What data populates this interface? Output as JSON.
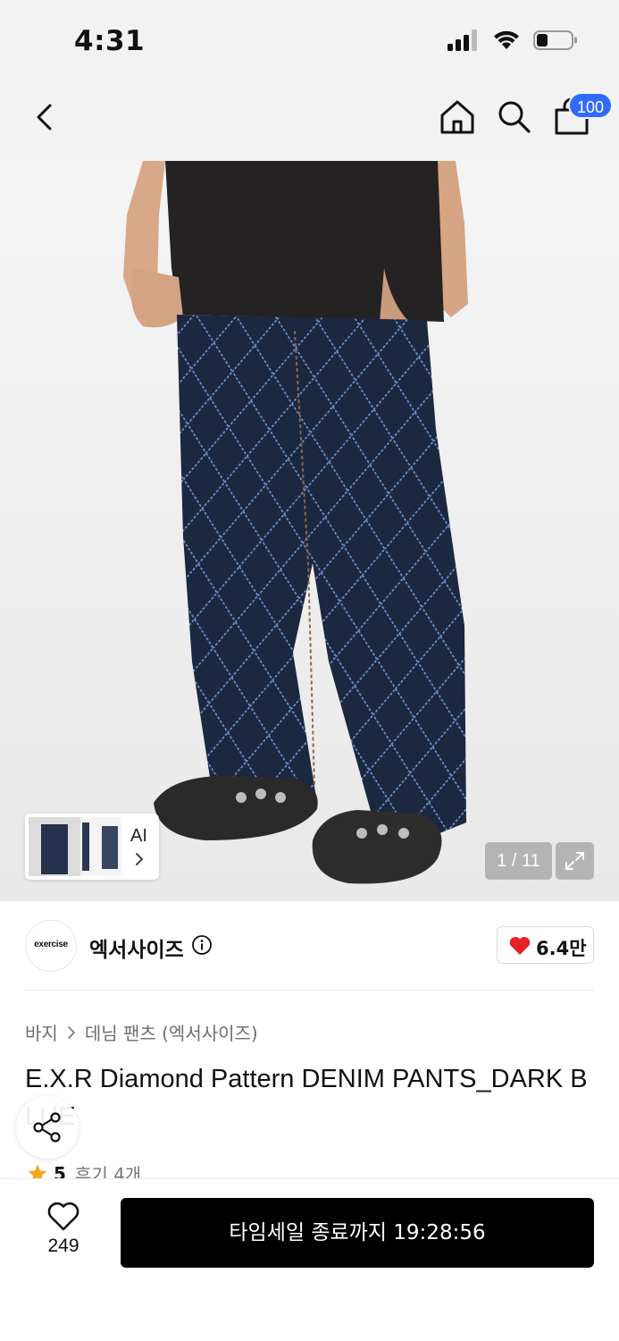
{
  "status_bar": {
    "time": "4:31"
  },
  "nav": {
    "cart_count": "100"
  },
  "gallery": {
    "counter": "1 / 11",
    "ai_label": "AI"
  },
  "brand": {
    "logo_text": "exercise",
    "name": "엑서사이즈",
    "likes": "6.4만"
  },
  "breadcrumb": {
    "category": "바지",
    "subcategory": "데님 팬츠 (엑서사이즈)"
  },
  "product": {
    "title": "E.X.R Diamond Pattern DENIM PANTS_DARK BLUE",
    "rating": "5",
    "reviews": "후기 4개"
  },
  "bottom": {
    "wish_count": "249",
    "buy_label": "타임세일 종료까지 19:28:56"
  },
  "colors": {
    "accent_blue": "#2f6bff",
    "heart_red": "#e8202a",
    "star": "#f5a623",
    "denim": "#1f2a45"
  }
}
